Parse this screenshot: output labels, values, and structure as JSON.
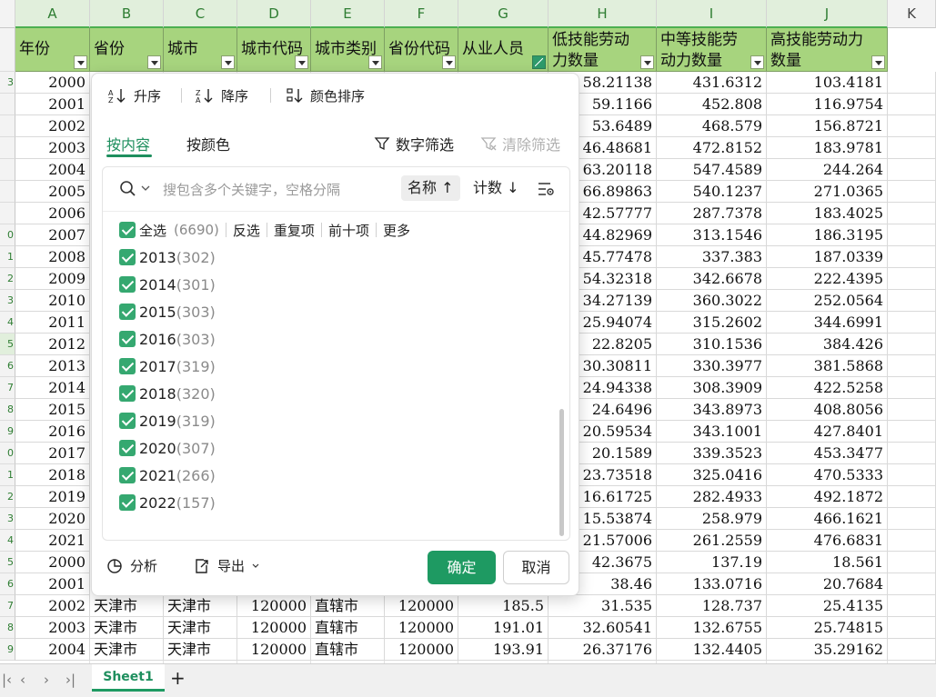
{
  "columns": [
    "A",
    "B",
    "C",
    "D",
    "E",
    "F",
    "G",
    "H",
    "I",
    "J",
    "K"
  ],
  "headers": [
    {
      "text": "年份"
    },
    {
      "text": "省份"
    },
    {
      "text": "城市"
    },
    {
      "text": "城市代码"
    },
    {
      "text": "城市类别"
    },
    {
      "text": "省份代码"
    },
    {
      "text": "从业人员"
    },
    {
      "text": "低技能劳动力数量"
    },
    {
      "text": "中等技能劳动力数量"
    },
    {
      "text": "高技能劳动力数量"
    }
  ],
  "row_numbers": [
    "",
    "3",
    "",
    "",
    "",
    "",
    "",
    "",
    "0",
    "1",
    "2",
    "3",
    "4",
    "5",
    "6",
    "7",
    "8",
    "9",
    "0",
    "1",
    "2",
    "3",
    "4",
    "5",
    "6",
    "7",
    "8",
    "9"
  ],
  "years_a": [
    "2000",
    "2001",
    "2002",
    "2003",
    "2004",
    "2005",
    "2006",
    "2007",
    "2008",
    "2009",
    "2010",
    "2011",
    "2012",
    "2013",
    "2014",
    "2015",
    "2016",
    "2017",
    "2018",
    "2019",
    "2020",
    "2021",
    "2000",
    "2001",
    "2002",
    "2003",
    "2004"
  ],
  "col_h": [
    "58.21138",
    "59.1166",
    "53.6489",
    "46.48681",
    "63.20118",
    "66.89863",
    "42.57777",
    "44.82969",
    "45.77478",
    "54.32318",
    "34.27139",
    "25.94074",
    "22.8205",
    "30.30811",
    "24.94338",
    "24.6496",
    "20.59534",
    "20.1589",
    "23.73518",
    "16.61725",
    "15.53874",
    "21.57006",
    "42.3675",
    "38.46",
    "31.535",
    "32.60541",
    "26.37176"
  ],
  "col_i": [
    "431.6312",
    "452.808",
    "468.579",
    "472.8152",
    "547.4589",
    "540.1237",
    "287.7378",
    "313.1546",
    "337.383",
    "342.6678",
    "360.3022",
    "315.2602",
    "310.1536",
    "330.3977",
    "308.3909",
    "343.8973",
    "343.1001",
    "339.3523",
    "325.0416",
    "282.4933",
    "258.979",
    "261.2559",
    "137.19",
    "133.0716",
    "128.737",
    "132.6755",
    "132.4405"
  ],
  "col_j": [
    "103.4181",
    "116.9754",
    "156.8721",
    "183.9781",
    "244.264",
    "271.0365",
    "183.4025",
    "186.3195",
    "187.0339",
    "222.4395",
    "252.0564",
    "344.6991",
    "384.426",
    "381.5868",
    "422.5258",
    "408.8056",
    "427.8401",
    "453.3477",
    "470.5333",
    "492.1872",
    "466.1621",
    "476.6831",
    "18.561",
    "20.7684",
    "25.4135",
    "25.74815",
    "35.29162"
  ],
  "bottom_rows": [
    {
      "b": "天津市",
      "c": "天津市",
      "d": "120000",
      "e": "直辖市",
      "f": "120000",
      "g": "185.5"
    },
    {
      "b": "天津市",
      "c": "天津市",
      "d": "120000",
      "e": "直辖市",
      "f": "120000",
      "g": "191.01"
    },
    {
      "b": "天津市",
      "c": "天津市",
      "d": "120000",
      "e": "直辖市",
      "f": "120000",
      "g": "193.91"
    }
  ],
  "dropdown": {
    "sort_asc": "升序",
    "sort_desc": "降序",
    "sort_color": "颜色排序",
    "tab_content": "按内容",
    "tab_color": "按颜色",
    "number_filter": "数字筛选",
    "clear_filter": "清除筛选",
    "search_placeholder": "搜包含多个关键字，空格分隔",
    "sort_name": "名称 ↑",
    "sort_count": "计数 ↓",
    "select_all": "全选",
    "select_all_count": "(6690)",
    "invert": "反选",
    "duplicates": "重复项",
    "top_ten": "前十项",
    "more": "更多",
    "items": [
      {
        "year": "2013",
        "count": "(302)"
      },
      {
        "year": "2014",
        "count": "(301)"
      },
      {
        "year": "2015",
        "count": "(303)"
      },
      {
        "year": "2016",
        "count": "(303)"
      },
      {
        "year": "2017",
        "count": "(319)"
      },
      {
        "year": "2018",
        "count": "(320)"
      },
      {
        "year": "2019",
        "count": "(319)"
      },
      {
        "year": "2020",
        "count": "(307)"
      },
      {
        "year": "2021",
        "count": "(266)"
      },
      {
        "year": "2022",
        "count": "(157)"
      }
    ],
    "analyze": "分析",
    "export": "导出",
    "ok": "确定",
    "cancel": "取消"
  },
  "sheet_tab": "Sheet1",
  "add_sheet": "+",
  "colors": {
    "accent": "#1e9a62",
    "header_fill": "#a7d47e"
  }
}
